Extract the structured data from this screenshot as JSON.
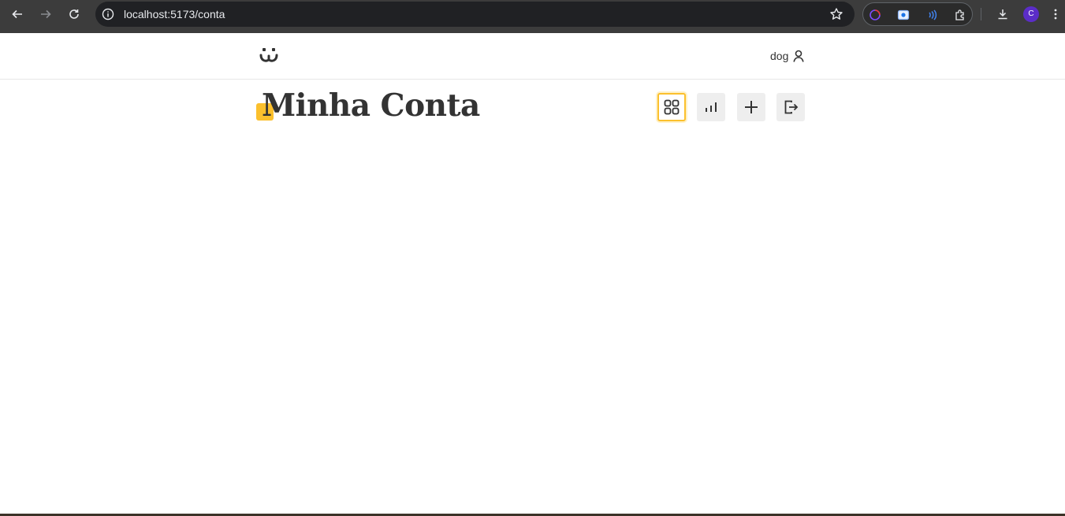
{
  "browser": {
    "url": "localhost:5173/conta",
    "profile_initial": "C",
    "nav": {
      "back_icon": "arrow-left-icon",
      "forward_icon": "arrow-right-icon",
      "reload_icon": "reload-icon"
    }
  },
  "header": {
    "logo_icon": "dog-face-logo-icon",
    "user_label": "dog",
    "user_icon": "person-icon"
  },
  "main": {
    "title": "Minha Conta",
    "actions": [
      {
        "name": "feed",
        "icon": "grid-icon",
        "active": true
      },
      {
        "name": "stats",
        "icon": "bar-chart-icon",
        "active": false
      },
      {
        "name": "post",
        "icon": "plus-icon",
        "active": false
      },
      {
        "name": "logout",
        "icon": "logout-icon",
        "active": false
      }
    ]
  },
  "colors": {
    "accent": "#fbc02d",
    "text": "#333333",
    "button_bg": "#eeeeee"
  }
}
